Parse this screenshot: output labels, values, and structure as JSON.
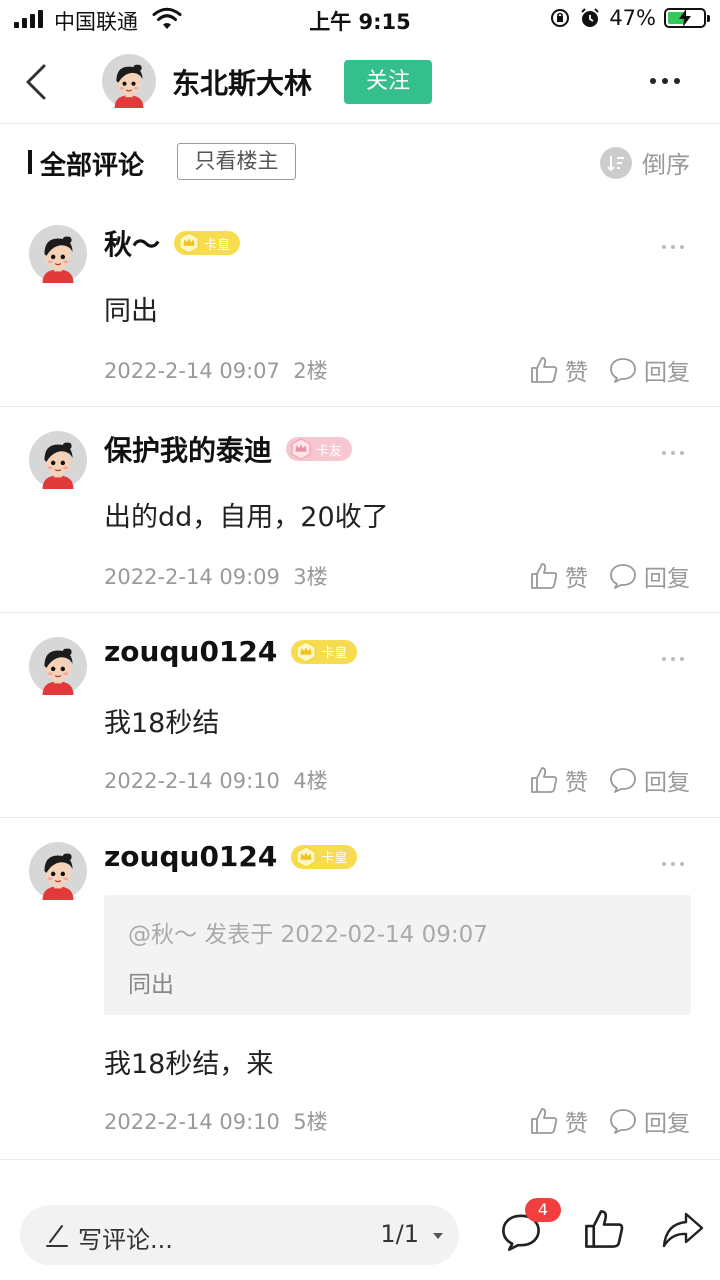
{
  "status_bar": {
    "carrier": "中国联通",
    "time": "上午 9:15",
    "battery": "47%",
    "battery_level": 0.47
  },
  "header": {
    "author_name": "东北斯大林",
    "follow_label": "关注"
  },
  "filter": {
    "title": "全部评论",
    "only_op_label": "只看楼主",
    "sort_label": "倒序"
  },
  "comments": [
    {
      "name": "秋～",
      "badge": "卡皇",
      "badge_color": "#f7dc4f",
      "text": "同出",
      "time": "2022-2-14 09:07",
      "floor": "2楼",
      "like_label": "赞",
      "reply_label": "回复"
    },
    {
      "name": "保护我的泰迪",
      "badge": "卡友",
      "badge_color": "#f7c7d1",
      "text": "出的dd，自用，20收了",
      "time": "2022-2-14 09:09",
      "floor": "3楼",
      "like_label": "赞",
      "reply_label": "回复"
    },
    {
      "name": "zouqu0124",
      "badge": "卡皇",
      "badge_color": "#f7dc4f",
      "text": "我18秒结",
      "time": "2022-2-14 09:10",
      "floor": "4楼",
      "like_label": "赞",
      "reply_label": "回复"
    },
    {
      "name": "zouqu0124",
      "badge": "卡皇",
      "badge_color": "#f7dc4f",
      "quote_header": "@秋～ 发表于 2022-02-14 09:07",
      "quote_text": "同出",
      "text": "我18秒结，来",
      "time": "2022-2-14 09:10",
      "floor": "5楼",
      "like_label": "赞",
      "reply_label": "回复"
    }
  ],
  "bottom_bar": {
    "write_placeholder": "写评论...",
    "page_indicator": "1/1",
    "comment_count": "4"
  },
  "colors": {
    "accent_green": "#34bf8c",
    "count_red": "#f23e3e"
  }
}
